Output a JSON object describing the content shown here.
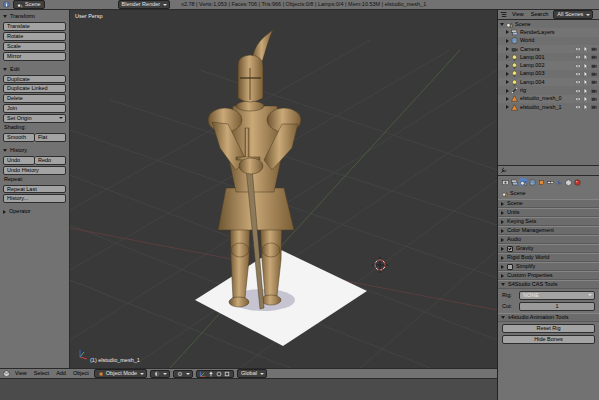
{
  "info_header": {
    "screen": "Scene",
    "engine": "Blender Render",
    "stats": "v2.78 | Verts:1,053 | Faces:706 | Tris:966 | Objects:0/8 | Lamps:0/4 | Mem:10.53M | elstudio_mesh_1"
  },
  "toolshelf": {
    "sections": [
      {
        "title": "Transform",
        "expanded": true,
        "rows": [
          [
            {
              "kind": "button",
              "label": "Translate"
            }
          ],
          [
            {
              "kind": "button",
              "label": "Rotate"
            }
          ],
          [
            {
              "kind": "button",
              "label": "Scale"
            }
          ],
          [
            {
              "kind": "button",
              "label": "Mirror"
            }
          ]
        ]
      },
      {
        "title": "Edit",
        "expanded": true,
        "rows": [
          [
            {
              "kind": "button",
              "label": "Duplicate"
            }
          ],
          [
            {
              "kind": "button",
              "label": "Duplicate Linked"
            }
          ],
          [
            {
              "kind": "button",
              "label": "Delete"
            }
          ],
          [
            {
              "kind": "button",
              "label": "Join"
            }
          ],
          [
            {
              "kind": "dropdown",
              "label": "Set Origin"
            }
          ],
          [
            {
              "kind": "label",
              "label": "Shading:"
            }
          ],
          [
            {
              "kind": "button",
              "label": "Smooth"
            },
            {
              "kind": "button",
              "label": "Flat"
            }
          ]
        ]
      },
      {
        "title": "History",
        "expanded": true,
        "rows": [
          [
            {
              "kind": "button",
              "label": "Undo"
            },
            {
              "kind": "button",
              "label": "Redo"
            }
          ],
          [
            {
              "kind": "button",
              "label": "Undo History"
            }
          ],
          [
            {
              "kind": "label",
              "label": "Repeat:"
            }
          ],
          [
            {
              "kind": "button",
              "label": "Repeat Last"
            }
          ],
          [
            {
              "kind": "button",
              "label": "History..."
            }
          ]
        ]
      }
    ],
    "operator": {
      "title": "Operator",
      "expanded": false
    }
  },
  "viewport": {
    "view_name": "User Persp",
    "object_label": "(1) elstudio_mesh_1"
  },
  "view_header": {
    "menus": [
      "View",
      "Select",
      "Add",
      "Object"
    ],
    "mode": "Object Mode",
    "orientation": "Global"
  },
  "outliner": {
    "menus": [
      "View",
      "Search"
    ],
    "display_mode": "All Scenes",
    "tree": [
      {
        "label": "Scene",
        "kind": "scene",
        "expanded": true,
        "children": [
          {
            "label": "RenderLayers",
            "kind": "render_layers",
            "expanded": false
          },
          {
            "label": "World",
            "kind": "world",
            "expanded": false
          },
          {
            "label": "Camera",
            "kind": "camera",
            "expanded": false
          },
          {
            "label": "Lamp.001",
            "kind": "lamp",
            "expanded": false
          },
          {
            "label": "Lamp.002",
            "kind": "lamp",
            "expanded": false
          },
          {
            "label": "Lamp.003",
            "kind": "lamp",
            "expanded": false
          },
          {
            "label": "Lamp.004",
            "kind": "lamp",
            "expanded": false
          },
          {
            "label": "rig",
            "kind": "armature",
            "expanded": false
          },
          {
            "label": "elstudio_mesh_0",
            "kind": "mesh",
            "expanded": false
          },
          {
            "label": "elstudio_mesh_1",
            "kind": "mesh",
            "expanded": false
          }
        ]
      }
    ]
  },
  "properties": {
    "tabs": [
      {
        "kind": "render",
        "selected": false
      },
      {
        "kind": "render_layers",
        "selected": false
      },
      {
        "kind": "scene",
        "selected": true
      },
      {
        "kind": "world",
        "selected": false
      },
      {
        "kind": "object",
        "selected": false
      },
      {
        "kind": "constraints",
        "selected": false
      },
      {
        "kind": "modifiers",
        "selected": false
      },
      {
        "kind": "data",
        "selected": false
      },
      {
        "kind": "material",
        "selected": false
      }
    ],
    "context": "Scene",
    "panels": [
      {
        "title": "Scene",
        "kind": "plain",
        "expanded": false
      },
      {
        "title": "Units",
        "kind": "plain",
        "expanded": false
      },
      {
        "title": "Keying Sets",
        "kind": "plain",
        "expanded": false
      },
      {
        "title": "Color Management",
        "kind": "plain",
        "expanded": false
      },
      {
        "title": "Audio",
        "kind": "plain",
        "expanded": false
      },
      {
        "title": "Gravity",
        "kind": "toggle",
        "checked": true,
        "expanded": false
      },
      {
        "title": "Rigid Body World",
        "kind": "plain",
        "expanded": false
      },
      {
        "title": "Simplify",
        "kind": "toggle",
        "checked": false,
        "expanded": false
      },
      {
        "title": "Custom Properties",
        "kind": "plain",
        "expanded": false
      },
      {
        "title": "S4Studio CAS Tools",
        "kind": "plain",
        "expanded": true,
        "fields": [
          {
            "kind": "dropdown",
            "label": "Rig:",
            "value": "NONE"
          },
          {
            "kind": "number",
            "label": "Cut:",
            "value": "1"
          }
        ]
      },
      {
        "title": "s4studio Animation Tools",
        "kind": "plain",
        "expanded": true,
        "fields": [
          {
            "kind": "button",
            "value": "Reset Rig"
          },
          {
            "kind": "button",
            "value": "Hide Bones"
          }
        ]
      }
    ]
  }
}
